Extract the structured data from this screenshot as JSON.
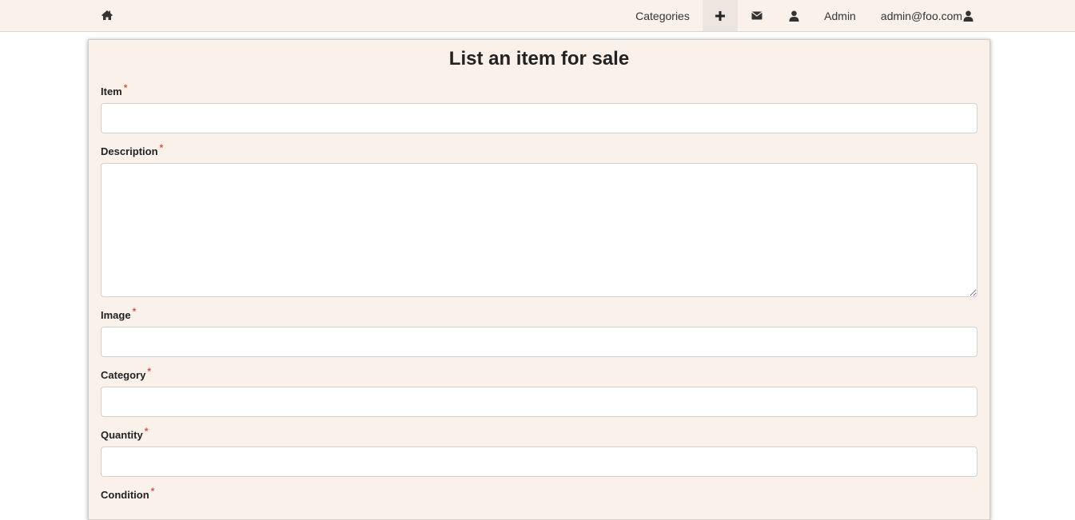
{
  "navbar": {
    "home_icon": "home-icon",
    "items": [
      {
        "label": "Categories"
      },
      {
        "icon": "plus-icon"
      },
      {
        "icon": "envelope-icon"
      },
      {
        "icon": "user-icon"
      },
      {
        "label": "Admin"
      },
      {
        "label": "admin@foo.com",
        "icon": "user-icon"
      }
    ],
    "active_index": 1
  },
  "form": {
    "title": "List an item for sale",
    "required_marker": "*",
    "fields": [
      {
        "label": "Item",
        "value": ""
      },
      {
        "label": "Description",
        "value": ""
      },
      {
        "label": "Image",
        "value": ""
      },
      {
        "label": "Category",
        "value": ""
      },
      {
        "label": "Quantity",
        "value": ""
      },
      {
        "label": "Condition",
        "value": ""
      }
    ]
  },
  "colors": {
    "navbar_bg": "#faf1eb",
    "panel_bg": "#faf1eb",
    "required": "#d9534f",
    "active_nav": "#ede6e0"
  }
}
